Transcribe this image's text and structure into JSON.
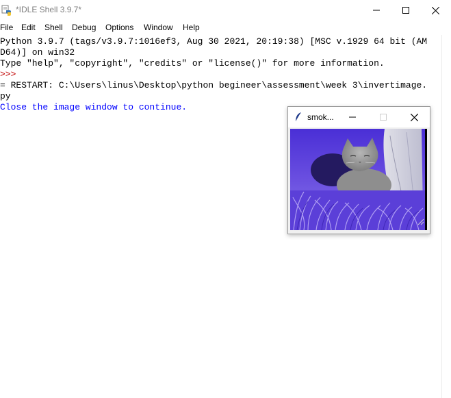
{
  "window": {
    "title": "*IDLE Shell 3.9.7*",
    "icon": "idle-python-icon",
    "controls": {
      "minimize": "minimize-icon",
      "maximize": "maximize-icon",
      "close": "close-icon"
    }
  },
  "menu": {
    "items": [
      {
        "label": "File"
      },
      {
        "label": "Edit"
      },
      {
        "label": "Shell"
      },
      {
        "label": "Debug"
      },
      {
        "label": "Options"
      },
      {
        "label": "Window"
      },
      {
        "label": "Help"
      }
    ]
  },
  "shell": {
    "lines": [
      {
        "text": "Python 3.9.7 (tags/v3.9.7:1016ef3, Aug 30 2021, 20:19:38) [MSC v.1929 64 bit (AM",
        "color": "#000000"
      },
      {
        "text": "D64)] on win32",
        "color": "#000000"
      },
      {
        "text": "Type \"help\", \"copyright\", \"credits\" or \"license()\" for more information.",
        "color": "#000000"
      },
      {
        "text": ">>> ",
        "color": "#c00000"
      },
      {
        "text": "= RESTART: C:\\Users\\linus\\Desktop\\python begineer\\assessment\\week 3\\invertimage.",
        "color": "#000000"
      },
      {
        "text": "py",
        "color": "#000000"
      },
      {
        "text": "Close the image window to continue.",
        "color": "#0000ff"
      }
    ]
  },
  "image_window": {
    "title": "smok...",
    "icon": "tk-feather-icon",
    "image_subject": "grey cat sitting in purple-tinted grass (color-inverted photo)",
    "controls": {
      "minimize": "minimize-icon",
      "maximize": "maximize-icon",
      "close": "close-icon"
    }
  },
  "colors": {
    "prompt": "#c00000",
    "stdout": "#0000ff",
    "text": "#000000",
    "image_tint": "#6a4fe0"
  }
}
